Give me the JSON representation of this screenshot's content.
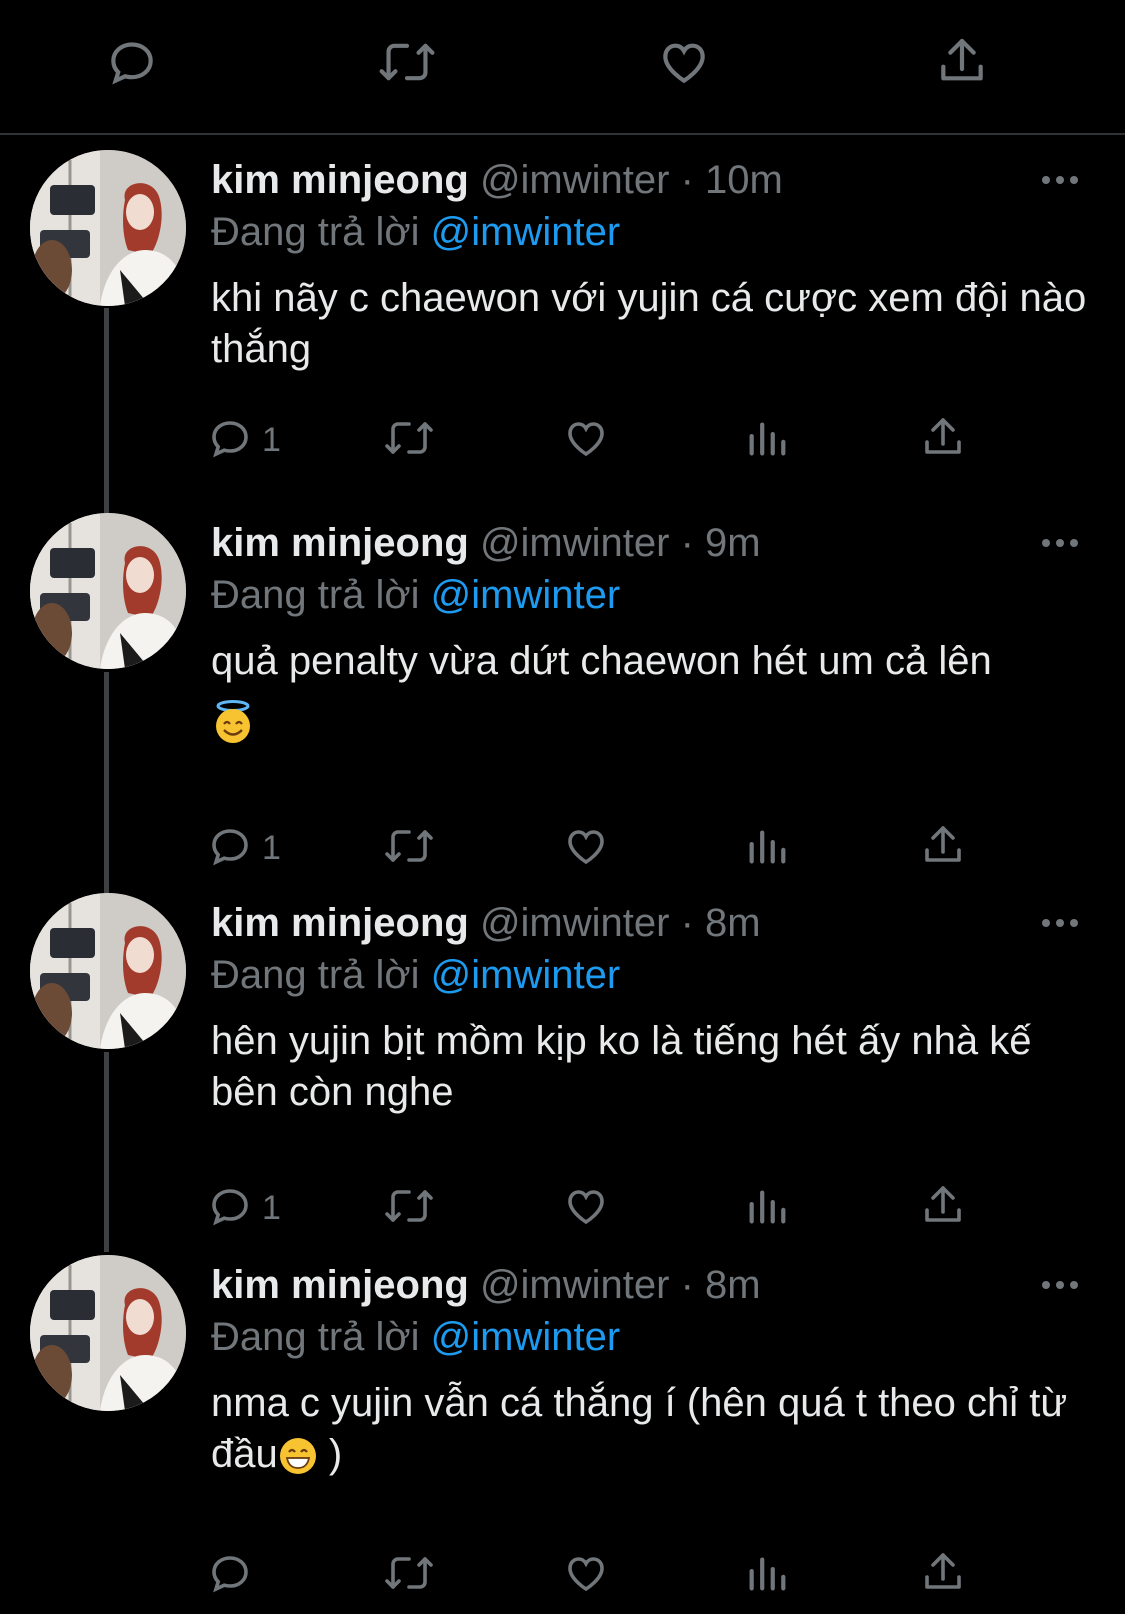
{
  "top_actions": [
    "reply-icon",
    "retweet-icon",
    "like-icon",
    "share-icon"
  ],
  "tweets": [
    {
      "name": "kim minjeong",
      "handle": "@imwinter",
      "sep": " · ",
      "time": "10m",
      "replying_label": "Đang trả lời",
      "replying_to": "@imwinter",
      "text": "khi nãy c chaewon với yujin cá cược xem đội nào thắng",
      "text_suffix": "",
      "reply_count": "1"
    },
    {
      "name": "kim minjeong",
      "handle": "@imwinter",
      "sep": " · ",
      "time": "9m",
      "replying_label": "Đang trả lời",
      "replying_to": "@imwinter",
      "text": "quả penalty vừa dứt chaewon hét um cả lên",
      "text_suffix": "",
      "emoji": "smiling-face-with-halo",
      "reply_count": "1"
    },
    {
      "name": "kim minjeong",
      "handle": "@imwinter",
      "sep": " · ",
      "time": "8m",
      "replying_label": "Đang trả lời",
      "replying_to": "@imwinter",
      "text": "hên yujin bịt mồm kịp ko là tiếng hét ấy nhà kế bên còn nghe",
      "text_suffix": "",
      "reply_count": "1"
    },
    {
      "name": "kim minjeong",
      "handle": "@imwinter",
      "sep": " · ",
      "time": "8m",
      "replying_label": "Đang trả lời",
      "replying_to": "@imwinter",
      "text": "nma c yujin vẫn cá thắng í (hên quá t theo chỉ từ đầu",
      "emoji_inline": "grinning-face",
      "text_suffix": " )",
      "reply_count": ""
    }
  ],
  "colors": {
    "background": "#000000",
    "text": "#e7e9ea",
    "muted": "#71767b",
    "accent": "#1d9bf0"
  }
}
